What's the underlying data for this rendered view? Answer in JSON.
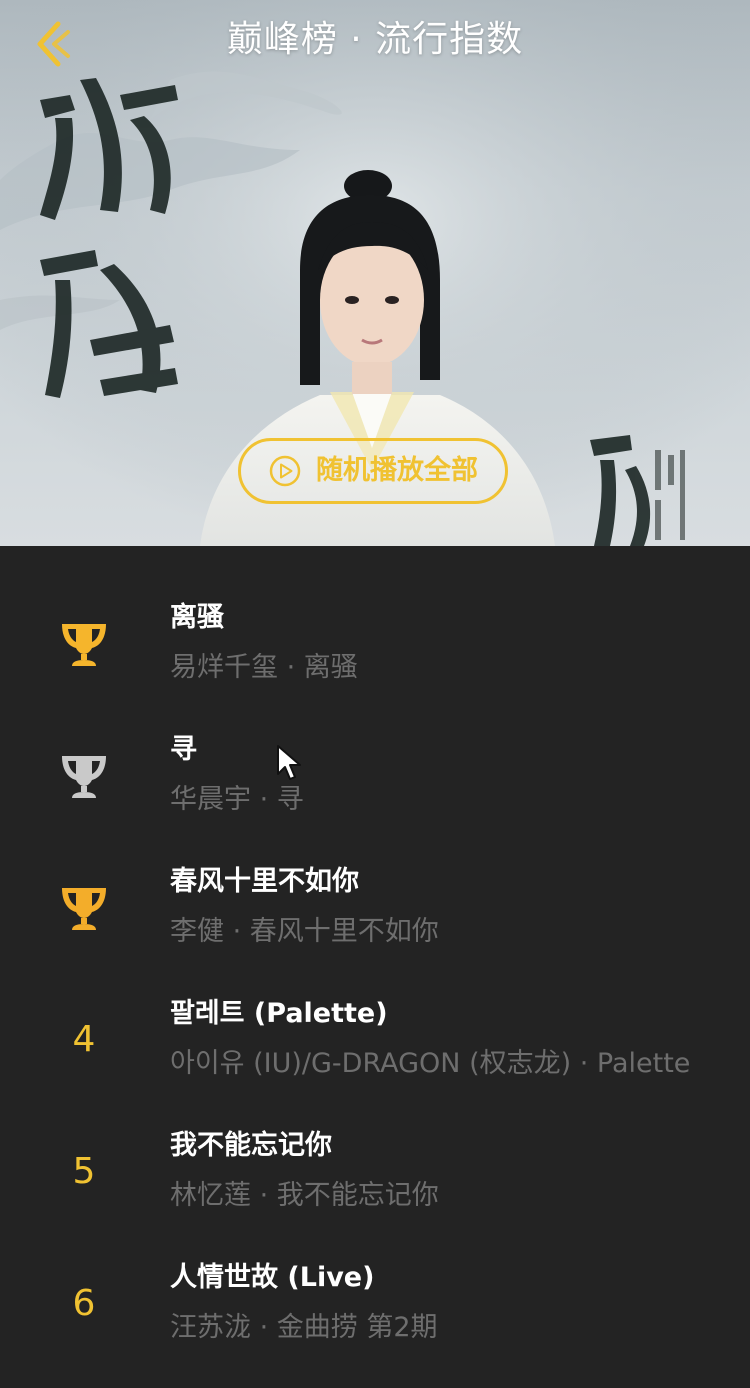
{
  "header": {
    "title": "巅峰榜 · 流行指数",
    "back_icon": "chevron-left-icon"
  },
  "hero": {
    "play_all_label": "随机播放全部",
    "play_icon": "play-circle-icon",
    "accent_color": "#f0c232"
  },
  "songs": [
    {
      "rank_display": "trophy-gold",
      "title": "离骚",
      "subtitle": "易烊千玺 · 离骚"
    },
    {
      "rank_display": "trophy-silver",
      "title": "寻",
      "subtitle": "华晨宇 · 寻"
    },
    {
      "rank_display": "trophy-bronze",
      "title": "春风十里不如你",
      "subtitle": "李健 · 春风十里不如你"
    },
    {
      "rank": "4",
      "title": "팔레트 (Palette)",
      "subtitle": "아이유 (IU)/G-DRAGON (权志龙) · Palette"
    },
    {
      "rank": "5",
      "title": "我不能忘记你",
      "subtitle": "林忆莲 · 我不能忘记你"
    },
    {
      "rank": "6",
      "title": "人情世故 (Live)",
      "subtitle": "汪苏泷 · 金曲捞 第2期"
    }
  ],
  "colors": {
    "list_background": "#232323",
    "title_text": "#ffffff",
    "subtitle_text": "#6e6e6e",
    "rank_color": "#f0c232",
    "gold_trophy": "#f5b52c",
    "silver_trophy": "#c9c9c9"
  }
}
